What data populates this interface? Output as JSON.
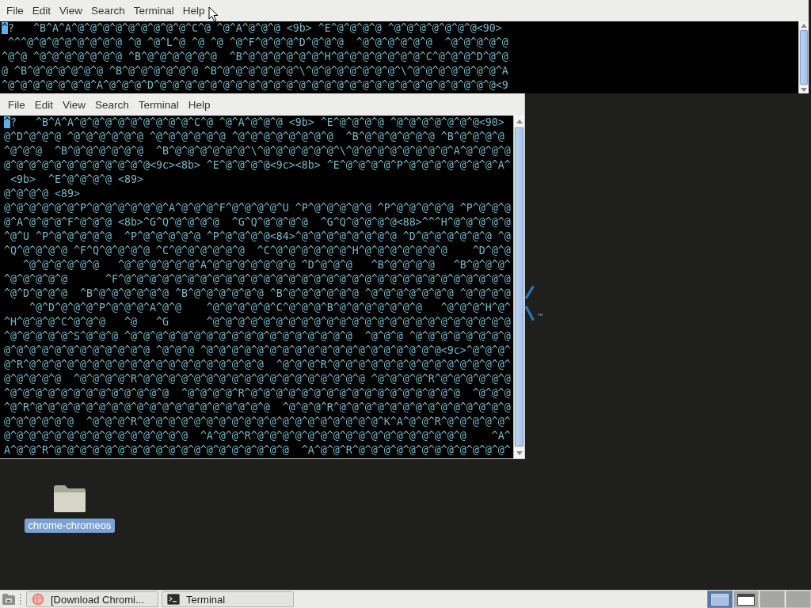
{
  "terminals": [
    {
      "menu": [
        "File",
        "Edit",
        "View",
        "Search",
        "Terminal",
        "Help"
      ],
      "cursor": true,
      "lines": [
        "^?   ^B^A^A^@^@^@^@^@^@^@^@^@^C^@ ^@^A^@^@^@ <9b> ^E^@^@^@^@ ^@^@^@^@^@^@^@<90>",
        " ^^^@^@^@^@^@^@^@^@ ^@ ^@^L^@ ^@ ^@ ^@^F^@^@^@^D^@^@^@  ^@^@^@^@^@^@  ^@^@^@^@^@",
        "^@^@ ^@^@^@^@^@^@^@ ^B^@^@^@^@^@^@  ^B^@^@^@^@^@^@^H^@^@^@^@^@^@^@^C^@^@^@^D^@^@",
        "@ ^B^@^@^@^@^@^@ ^B^@^@^@^@^@^@ ^B^@^@^@^@^@^@^\\^@^@^@^@^@^@^@^\\^@^@^@^@^@^@^@^A",
        "^@^@^@^@^@^@^@^A^@^@^@^D^@^@^@^@^@^@^@^@^@^@^@^@^@^@^@^@^@^@^@^@^@^@^@^@^@^@^@<9"
      ]
    },
    {
      "menu": [
        "File",
        "Edit",
        "View",
        "Search",
        "Terminal",
        "Help"
      ],
      "cursor": true,
      "lines": [
        "^?   ^B^A^A^@^@^@^@^@^@^@^@^@^C^@ ^@^A^@^@^@ <9b> ^E^@^@^@^@ ^@^@^@^@^@^@^@<90>",
        "@^D^@^@^@ ^@^@^@^@^@^@ ^@^@^@^@^@^@ ^@^@^@^@^@^@^@^@  ^B^@^@^@^@^@^@ ^B^@^@^@^@",
        "^@^@^@  ^B^@^@^@^@^@^@  ^B^@^@^@^@^@^@^\\^@^@^@^@^@^@^\\^@^@^@^@^@^@^@^@^A^@^@^@^@",
        "@^@^@^@^@^@^@^@^@^@^@^@<9c><8b> ^E^@^@^@^@<9c><8b> ^E^@^@^@^@^P^@^@^@^@^@^@^@^A^",
        " <9b>  ^E^@^@^@^@ <89>",
        "@^@^@^@ <89>",
        "@^@^@^@^@^@^P^@^@^@^@^@^@^A^@^@^@^F^@^@^@^@^U ^P^@^@^@^@^@ ^P^@^@^@^@^@ ^P^@^@^@",
        "@^A^@^@^@^F^@^@^@ <8b>^G^Q^@^@^@^@  ^G^Q^@^@^@^@  ^G^Q^@^@^@^@<88>^^^H^@^@^@^@^@",
        "^@^U ^P^@^@^@^@^@  ^P^@^@^@^@^@ ^P^@^@^@^@<84>^@^@^@^@^@^@^@^@ ^D^@^@^@^@^@^@ ^@",
        "^Q^@^@^@^@ ^F^Q^@^@^@^@ ^C^@^@^@^@^@^@  ^C^@^@^@^@^@^@^H^@^@^@^@^@^@^@    ^D^@^@",
        "   ^@^@^@^@^@^@   ^@^@^@^@^@^@^A^@^@^@^@^@^@^@ ^D^@^@^@   ^B^@^@^@^@   ^B^@^@^@^",
        "^@^@^@^@^@      ^F^@^@^@^@^@^@^@^@^@^@^@^@^@^@^@^@^@^@^@^@^@^@^@^@^@^@^@^@^@^@^@",
        "^@^D^@^@^@  ^B^@^@^@^@^@^@ ^B^@^@^@^@^@^@ ^B^@^@^@^@^@^@ ^@^@^@^@^@^@^@ ^@^@^@^@",
        "    ^@^D^@^@^@^P^@^@^@^A^@^@    ^@^@^@^@^@^C^@^@^@^B^@^@^@^@^@^@^@   ^@^@^@^H^@^",
        "^H^@^@^@^C^@^@^@   ^@   ^G      ^@^@^@^@^@^@^@^@^@^@^@^@^@^@^@^@^@^@^@^@^@^@^@^@",
        "^@^@^@^@^@^S^@^@^@ ^@^@^@^@^@^@^@^@^@^@^@^@^@^@^@^@^@^@  ^@^@^@ ^@^@^@^@^@^@^@^@",
        "@^@^@^@^@^@^@^@^@^@^@^@ ^@^@^@ ^@^@^@^@^@^@^@^@^@^@^@^@^@^@^@^@^@^@^@<9c>^@^@^@^",
        "@^R^@^@^@^@^@^@^@^@^@^@^@^@^@^@^@^@^@^@^@  ^@^@^@^R^@^@^@^@^@^@^@^@^@^@^@^@^@^@^",
        "@^@^@^@^@  ^@^@^@^@^R^@^@^@^@^@^@^@^@^@^@^@^@^@^@^@^@^@^@ ^@^@^@^@^R^@^@^@^@^@^@",
        "^@^@^@^@^@^@^@^@^@^@^@^@^@  ^@^@^@^@^R^@^@^@^@^@^@^@^@^@^@^@^@^@^@^@^@^@  ^@^@^@",
        "^@^R^@^@^@^@^@^@^@^@^@^@^@^@^@^@^@^@^@^@^@  ^@^@^@^R^@^@^@^@^@^@^@^@^@^@^@^@^@^@",
        "@^@^@^@^@^@  ^@^@^@^R^@^@^@^@^@^@^@^@^@^@^@^@^@^@^@^@^@^@^@^K^A^@^@^R^@^@^@^@^@^",
        "@^@^@^@^@^@^@^@^@^@^@^@^@^@^@  ^A^@^@^R^@^@^@^@^@^@^@^@^@^@^@^@^@^@^@^@^@    ^A^",
        "A^@^@^R^@^@^@^@^@^@^@^@^@^@^@^@^@^@^@^@^@^@^@  ^A^@^@^R^@^@^@^@^@^@^@^@^@^@^@^@^"
      ]
    }
  ],
  "wallpaper": {
    "mark": "™"
  },
  "desktop_icons": [
    {
      "label": "chrome-chromeos",
      "selected": true
    }
  ],
  "taskbar": {
    "tasks": [
      {
        "kind": "browser",
        "label": "[Download Chromi..."
      },
      {
        "kind": "terminal",
        "label": "Terminal"
      }
    ],
    "workspaces": [
      {
        "selected": true,
        "occupied": true
      },
      {
        "selected": false,
        "occupied": true
      },
      {
        "selected": false,
        "occupied": false
      },
      {
        "selected": false,
        "occupied": false
      }
    ]
  }
}
